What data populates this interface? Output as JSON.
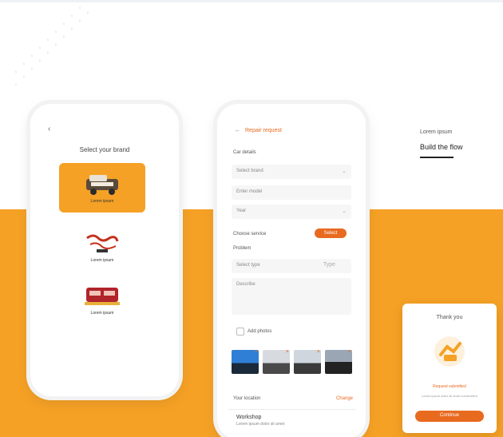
{
  "phone1": {
    "title": "Select your brand",
    "brands": [
      {
        "label": "Lorem ipsum",
        "selected": true
      },
      {
        "label": "Lorem ipsum",
        "selected": false
      },
      {
        "label": "Lorem ipsum",
        "selected": false
      }
    ]
  },
  "phone2": {
    "header_back": "←",
    "header_title": "Repair request",
    "section_details": "Car details",
    "field_brand": "Select brand",
    "field_model": "Enter model",
    "field_year": "Year",
    "row_service": "Choose service",
    "btn_select": "Select",
    "section_problem": "Problem",
    "field_type": "Select type",
    "field_type_value": "Type",
    "textarea_placeholder": "Describe",
    "upload_label": "Add photos",
    "link_label": "Your location",
    "link_action": "Change",
    "card_name": "Workshop",
    "card_desc": "Lorem ipsum dolor sit amet"
  },
  "right_block": {
    "label": "Lorem ipsum",
    "title": "Build the flow"
  },
  "success": {
    "title": "Thank you",
    "message": "Request submitted",
    "sub": "Lorem ipsum dolor sit amet consectetur",
    "button": "Continue"
  },
  "colors": {
    "accent_orange": "#f5a126",
    "button_orange": "#e86a1f"
  }
}
